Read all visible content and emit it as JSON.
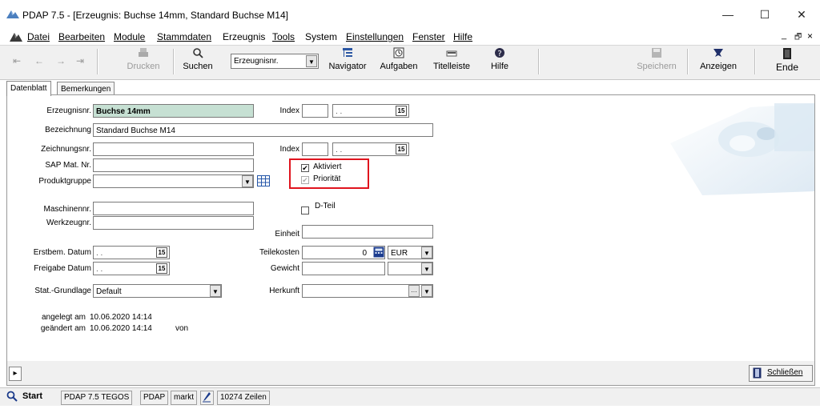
{
  "window": {
    "title": "PDAP 7.5 - [Erzeugnis: Buchse 14mm, Standard Buchse M14]",
    "minimize": "—",
    "maximize": "☐",
    "close": "✕"
  },
  "menu": {
    "items": [
      "Datei",
      "Bearbeiten",
      "Module",
      "Stammdaten",
      "Erzeugnis",
      "Tools",
      "System",
      "Einstellungen",
      "Fenster",
      "Hilfe"
    ],
    "mdi_min": "_",
    "mdi_restore": "🗗",
    "mdi_close": "×"
  },
  "toolbar": {
    "first": "⇤",
    "prev": "←",
    "next": "→",
    "last": "⇥",
    "print": "Drucken",
    "search": "Suchen",
    "search_combo": "Erzeugnisnr.",
    "navigator": "Navigator",
    "tasks": "Aufgaben",
    "titlebar": "Titelleiste",
    "help": "Hilfe",
    "save": "Speichern",
    "show": "Anzeigen",
    "end": "Ende"
  },
  "tabs": [
    "Datenblatt",
    "Bemerkungen"
  ],
  "form": {
    "erzeugnisnr_label": "Erzeugnisnr.",
    "erzeugnisnr_value": "Buchse 14mm",
    "index_label": "Index",
    "date_placeholder": ". .",
    "bezeichnung_label": "Bezeichnung",
    "bezeichnung_value": "Standard Buchse M14",
    "zeichnungsnr_label": "Zeichnungsnr.",
    "sap_label": "SAP Mat. Nr.",
    "produktgruppe_label": "Produktgruppe",
    "aktiviert_label": "Aktiviert",
    "prioritaet_label": "Priorität",
    "maschinennr_label": "Maschinennr.",
    "werkzeugnr_label": "Werkzeugnr.",
    "dteil_label": "D-Teil",
    "einheit_label": "Einheit",
    "erstbem_label": "Erstbem. Datum",
    "freigabe_label": "Freigabe Datum",
    "teilekosten_label": "Teilekosten",
    "teilekosten_value": "0",
    "currency_value": "EUR",
    "gewicht_label": "Gewicht",
    "stat_label": "Stat.-Grundlage",
    "stat_value": "Default",
    "herkunft_label": "Herkunft",
    "angelegt_label": "angelegt am",
    "angelegt_value": "10.06.2020  14:14",
    "geaendert_label": "geändert am",
    "geaendert_value": "10.06.2020  14:14",
    "von_label": "von"
  },
  "bottom": {
    "expand": "▸",
    "close_label": "Schließen"
  },
  "status": {
    "start": "Start",
    "cells": [
      "PDAP 7.5 TEGOS",
      "PDAP",
      "markt"
    ],
    "rows": "10274 Zeilen"
  },
  "colors": {
    "highlight_field": "#c6e0d3",
    "red_frame": "#e0141e"
  }
}
